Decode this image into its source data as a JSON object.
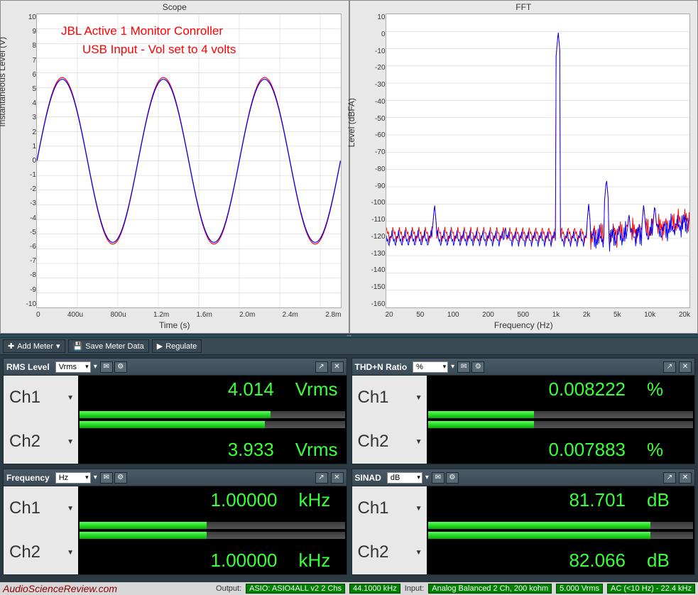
{
  "chart_data": [
    {
      "type": "line",
      "title": "Scope",
      "xlabel": "Time (s)",
      "ylabel": "Instantaneous Level (V)",
      "xlim": [
        0,
        0.003
      ],
      "ylim": [
        -10,
        10
      ],
      "x_ticks": [
        "0",
        "400u",
        "800u",
        "1.2m",
        "1.6m",
        "2.0m",
        "2.4m",
        "2.8m"
      ],
      "y_ticks": [
        10,
        9,
        8,
        7,
        6,
        5,
        4,
        3,
        2,
        1,
        0,
        -1,
        -2,
        -3,
        -4,
        -5,
        -6,
        -7,
        -8,
        -9,
        -10
      ],
      "series": [
        {
          "name": "Ch1",
          "color": "red",
          "amplitude": 5.68,
          "frequency_hz": 1000,
          "waveform": "sine"
        },
        {
          "name": "Ch2",
          "color": "blue",
          "amplitude": 5.56,
          "frequency_hz": 1000,
          "waveform": "sine"
        }
      ],
      "annotations": [
        "JBL Active 1 Monitor Conroller",
        "USB Input - Vol set to 4 volts"
      ]
    },
    {
      "type": "line",
      "title": "FFT",
      "xlabel": "Frequency (Hz)",
      "ylabel": "Level (dBFA)",
      "xscale": "log",
      "xlim": [
        20,
        20000
      ],
      "ylim": [
        -160,
        10
      ],
      "x_ticks": [
        "20",
        "50",
        "100",
        "200",
        "500",
        "1k",
        "2k",
        "5k",
        "10k",
        "20k"
      ],
      "y_ticks": [
        10,
        0,
        -10,
        -20,
        -30,
        -40,
        -50,
        -60,
        -70,
        -80,
        -90,
        -100,
        -110,
        -120,
        -130,
        -140,
        -150,
        -160
      ],
      "series_colors": [
        "red",
        "blue"
      ],
      "fundamental": {
        "frequency_hz": 1000,
        "level_db": 0
      },
      "harmonics_approx_db": [
        {
          "freq": 60,
          "level": -100
        },
        {
          "freq": 180,
          "level": -115
        },
        {
          "freq": 300,
          "level": -112
        },
        {
          "freq": 2000,
          "level": -100
        },
        {
          "freq": 3000,
          "level": -85
        },
        {
          "freq": 4000,
          "level": -112
        },
        {
          "freq": 5000,
          "level": -105
        },
        {
          "freq": 7000,
          "level": -100
        },
        {
          "freq": 9000,
          "level": -100
        }
      ],
      "noise_floor_approx_db": -120
    }
  ],
  "toolbar": {
    "add_meter": "Add Meter",
    "save_data": "Save Meter Data",
    "regulate": "Regulate"
  },
  "meters": {
    "rms": {
      "title": "RMS Level",
      "unit_selected": "Vrms",
      "ch1_label": "Ch1",
      "ch2_label": "Ch2",
      "ch1_value": "4.014",
      "ch1_unit": "Vrms",
      "ch2_value": "3.933",
      "ch2_unit": "Vrms",
      "ch1_bar_pct": 72,
      "ch2_bar_pct": 70
    },
    "thdn": {
      "title": "THD+N Ratio",
      "unit_selected": "%",
      "ch1_label": "Ch1",
      "ch2_label": "Ch2",
      "ch1_value": "0.008222",
      "ch1_unit": "%",
      "ch2_value": "0.007883",
      "ch2_unit": "%",
      "ch1_bar_pct": 40,
      "ch2_bar_pct": 40
    },
    "freq": {
      "title": "Frequency",
      "unit_selected": "Hz",
      "ch1_label": "Ch1",
      "ch2_label": "Ch2",
      "ch1_value": "1.00000",
      "ch1_unit": "kHz",
      "ch2_value": "1.00000",
      "ch2_unit": "kHz",
      "ch1_bar_pct": 48,
      "ch2_bar_pct": 48
    },
    "sinad": {
      "title": "SINAD",
      "unit_selected": "dB",
      "ch1_label": "Ch1",
      "ch2_label": "Ch2",
      "ch1_value": "81.701",
      "ch1_unit": "dB",
      "ch2_value": "82.066",
      "ch2_unit": "dB",
      "ch1_bar_pct": 84,
      "ch2_bar_pct": 84
    }
  },
  "statusbar": {
    "watermark": "AudioScienceReview.com",
    "output_label": "Output:",
    "output_device": "ASIO: ASIO4ALL v2 2 Chs",
    "output_rate": "44.1000 kHz",
    "input_label": "Input:",
    "input_device": "Analog Balanced 2 Ch, 200 kohm",
    "input_level": "5.000 Vrms",
    "input_coupling": "AC (<10 Hz) - 22.4 kHz"
  }
}
